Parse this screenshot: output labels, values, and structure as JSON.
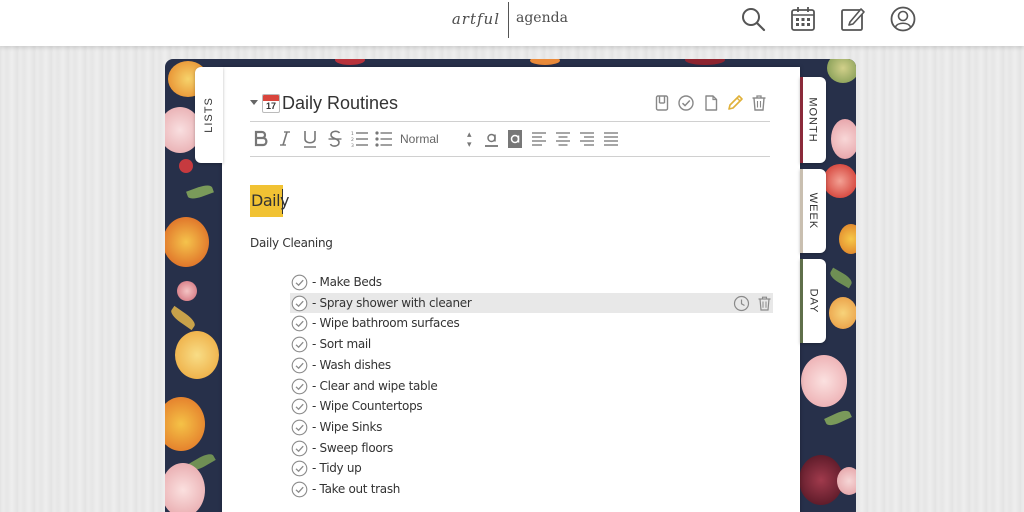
{
  "header": {
    "logo_left": "artful",
    "logo_right": "agenda",
    "icons": [
      "search-icon",
      "calendar-icon",
      "compose-icon",
      "account-icon"
    ]
  },
  "tabs": {
    "lists": "LISTS",
    "month": "MONTH",
    "week": "WEEK",
    "day": "DAY"
  },
  "list": {
    "title_emoji_day": "17",
    "title": "Daily Routines",
    "actions": [
      "save-icon",
      "checkmark-icon",
      "document-icon",
      "pencil-icon",
      "trash-icon"
    ]
  },
  "toolbar": {
    "format_value": "Normal",
    "tools": [
      "bold",
      "italic",
      "underline",
      "strikethrough",
      "numbered-list",
      "bullet-list",
      "font-color",
      "highlight-color",
      "align-left",
      "align-center",
      "align-right",
      "justify"
    ]
  },
  "content": {
    "heading": "Daily",
    "subheading": "Daily Cleaning",
    "tasks": [
      "- Make Beds",
      "- Spray shower with cleaner",
      "- Wipe bathroom surfaces",
      "- Sort mail",
      "- Wash dishes",
      "- Clear and wipe table",
      "- Wipe Countertops",
      "- Wipe Sinks",
      "- Sweep floors",
      "- Tidy up",
      "- Take out trash"
    ],
    "highlighted_task_index": 1
  },
  "colors": {
    "header_bg": "#ffffff",
    "planner_bg": "#27304a",
    "highlight_yellow": "#f1c233",
    "pencil_icon": "#e0b13a",
    "tab_strip_month": "#8b2a3a",
    "tab_strip_week": "#c9bfb0",
    "tab_strip_day": "#5f6f4a"
  }
}
